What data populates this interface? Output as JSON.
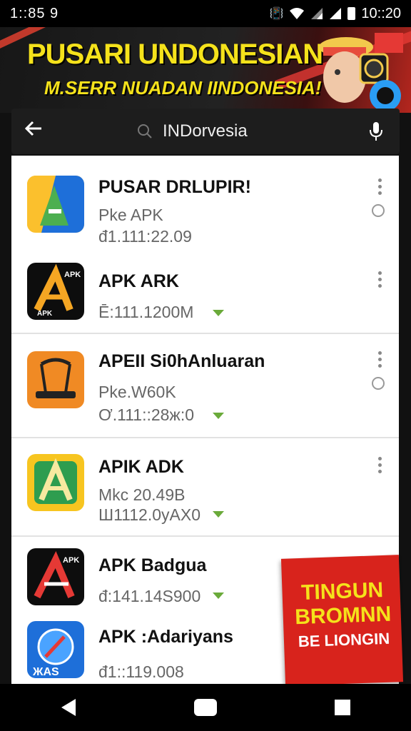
{
  "status_bar": {
    "left_text": "1::85  9",
    "time": "10::20"
  },
  "banner": {
    "title": "PUSARI UNDONESIAN",
    "subtitle": "M.SERR NUADAN IINDONESIA!"
  },
  "search": {
    "query": "INDorvesia"
  },
  "apps": [
    {
      "name": "PUSAR DRLUPIR!",
      "line1": "Pke APK",
      "line2": "đ1.111:22.09"
    },
    {
      "name": "APK ARK",
      "line1": "",
      "line2": "Ē:111.1200Μ"
    },
    {
      "name": "APEII Si0hAnluaran",
      "line1": "Pke.W60K",
      "line2": "Ơ.111::28ж:0"
    },
    {
      "name": "APIK ADK",
      "line1": "Μkc 20.49Β",
      "line2": "Ш1112.0уАХ0"
    },
    {
      "name": "APK Badgua",
      "line1": "",
      "line2": "đ:141.14S900"
    },
    {
      "name": "APK :Adariyans",
      "line1": "",
      "line2": "đ1::119.008"
    }
  ],
  "icon_labels": {
    "apk_small": "APK",
    "apk_small2": "APK",
    "apk_small3": "APK",
    "as": "ЖAS"
  },
  "promo": {
    "line1": "TINGUN",
    "line2": "BROMNN",
    "line3": "BE LIONGIN"
  },
  "colors": {
    "banner_yellow": "#f5e21b",
    "promo_red": "#d8231c",
    "accent_green": "#6aaa3a"
  }
}
